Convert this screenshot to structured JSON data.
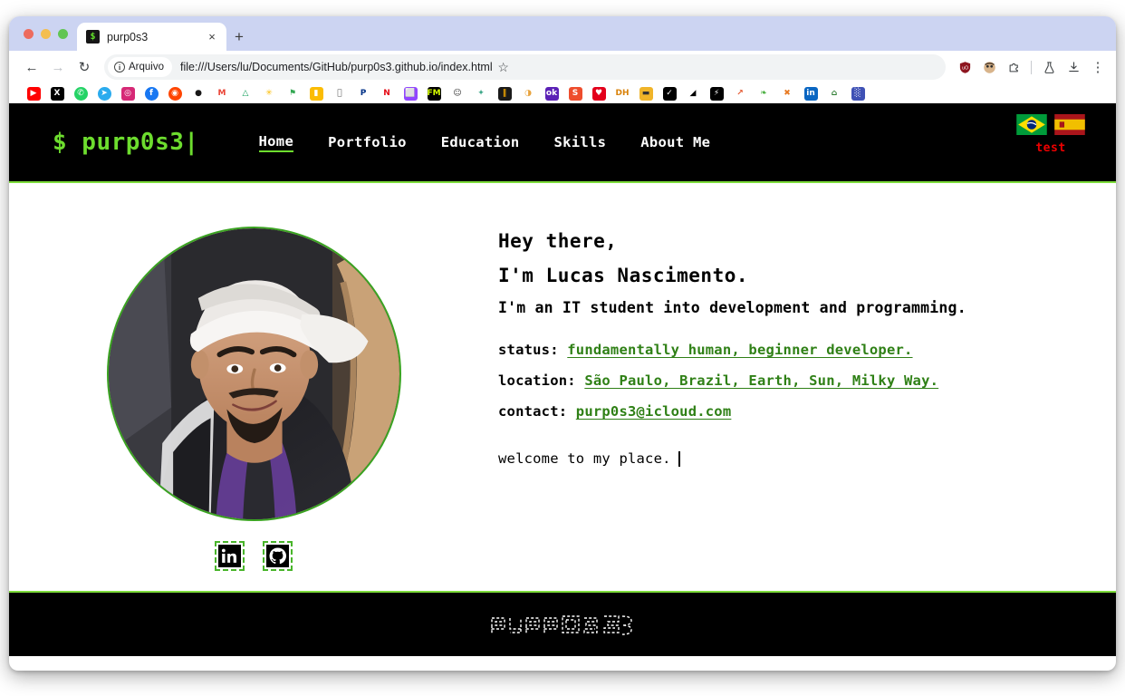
{
  "browser": {
    "tab": {
      "title": "purp0s3",
      "favicon_glyph": "$",
      "close_label": "×"
    },
    "new_tab_label": "+",
    "nav": {
      "back": "←",
      "forward": "→",
      "reload": "↻"
    },
    "omnibox": {
      "site_chip_label": "Arquivo",
      "info_glyph": "i",
      "url": "file:///Users/lu/Documents/GitHub/purp0s3.github.io/index.html"
    },
    "toolbar_icons": [
      {
        "name": "bookmark-star-icon",
        "glyph": "☆"
      },
      {
        "name": "ublock-shield-icon",
        "glyph": "●",
        "color": "#8e1620"
      },
      {
        "name": "extension-avatar-icon",
        "glyph": "●",
        "color": "#c49a6c"
      },
      {
        "name": "extensions-puzzle-icon",
        "glyph": "⬚",
        "color": "#3c4043"
      },
      {
        "name": "labs-flask-icon",
        "glyph": "⚗",
        "color": "#3c4043"
      },
      {
        "name": "downloads-icon",
        "glyph": "⤓",
        "color": "#3c4043"
      },
      {
        "name": "browser-menu-icon",
        "glyph": "⋮",
        "color": "#3c4043"
      }
    ],
    "bookmarks": [
      {
        "name": "youtube",
        "label": "▶",
        "bg": "#ff0000",
        "fg": "#ffffff",
        "shape": "rect"
      },
      {
        "name": "x-twitter",
        "label": "X",
        "bg": "#000000",
        "fg": "#ffffff",
        "shape": "rect"
      },
      {
        "name": "whatsapp",
        "label": "✆",
        "bg": "#25d366",
        "fg": "#ffffff",
        "shape": "circle"
      },
      {
        "name": "telegram",
        "label": "➤",
        "bg": "#2aabee",
        "fg": "#ffffff",
        "shape": "circle"
      },
      {
        "name": "instagram",
        "label": "◎",
        "bg": "#d62976",
        "fg": "#ffffff",
        "shape": "rect"
      },
      {
        "name": "facebook",
        "label": "f",
        "bg": "#1877f2",
        "fg": "#ffffff",
        "shape": "circle"
      },
      {
        "name": "reddit",
        "label": "◉",
        "bg": "#ff4500",
        "fg": "#ffffff",
        "shape": "circle"
      },
      {
        "name": "github",
        "label": "●",
        "bg": "#ffffff",
        "fg": "#181717",
        "shape": "circle"
      },
      {
        "name": "gmail",
        "label": "M",
        "bg": "#ffffff",
        "fg": "#ea4335",
        "shape": "rect"
      },
      {
        "name": "google-drive",
        "label": "△",
        "bg": "#ffffff",
        "fg": "#0f9d58",
        "shape": "rect"
      },
      {
        "name": "google-photos",
        "label": "✳",
        "bg": "#ffffff",
        "fg": "#fbbc04",
        "shape": "rect"
      },
      {
        "name": "google-maps",
        "label": "⚑",
        "bg": "#ffffff",
        "fg": "#34a853",
        "shape": "rect"
      },
      {
        "name": "google-keep",
        "label": "▮",
        "bg": "#fbbc04",
        "fg": "#ffffff",
        "shape": "rect"
      },
      {
        "name": "apple",
        "label": "",
        "bg": "#ffffff",
        "fg": "#555555",
        "shape": "rect"
      },
      {
        "name": "paypal",
        "label": "P",
        "bg": "#ffffff",
        "fg": "#003087",
        "shape": "rect"
      },
      {
        "name": "netflix",
        "label": "N",
        "bg": "#ffffff",
        "fg": "#e50914",
        "shape": "rect"
      },
      {
        "name": "twitch",
        "label": "⬜",
        "bg": "#9146ff",
        "fg": "#ffffff",
        "shape": "rect"
      },
      {
        "name": "fm-app",
        "label": "FM",
        "bg": "#000000",
        "fg": "#d6ff00",
        "shape": "rect"
      },
      {
        "name": "smiley-app",
        "label": "☺",
        "bg": "#ffffff",
        "fg": "#333333",
        "shape": "rect"
      },
      {
        "name": "star-app",
        "label": "✦",
        "bg": "#ffffff",
        "fg": "#3fa88a",
        "shape": "rect"
      },
      {
        "name": "charts-app",
        "label": "‖",
        "bg": "#1a1a1a",
        "fg": "#f0a500",
        "shape": "rect"
      },
      {
        "name": "taco-app",
        "label": "◑",
        "bg": "#ffffff",
        "fg": "#e8a33d",
        "shape": "rect"
      },
      {
        "name": "ok-app",
        "label": "ok",
        "bg": "#5b21b6",
        "fg": "#ffffff",
        "shape": "rect"
      },
      {
        "name": "shopee",
        "label": "S",
        "bg": "#ee4d2d",
        "fg": "#ffffff",
        "shape": "rect"
      },
      {
        "name": "heart-app",
        "label": "♥",
        "bg": "#e3001b",
        "fg": "#ffffff",
        "shape": "rect"
      },
      {
        "name": "dh-app",
        "label": "DH",
        "bg": "#ffffff",
        "fg": "#d9820a",
        "shape": "rect"
      },
      {
        "name": "bag-app",
        "label": "▬",
        "bg": "#f0b429",
        "fg": "#333333",
        "shape": "rect"
      },
      {
        "name": "nike",
        "label": "✓",
        "bg": "#000000",
        "fg": "#ffffff",
        "shape": "rect"
      },
      {
        "name": "adidas",
        "label": "◢",
        "bg": "#ffffff",
        "fg": "#000000",
        "shape": "rect"
      },
      {
        "name": "flash-app",
        "label": "⚡",
        "bg": "#000000",
        "fg": "#ffffff",
        "shape": "rect"
      },
      {
        "name": "swoosh-app",
        "label": "↗",
        "bg": "#ffffff",
        "fg": "#e4572e",
        "shape": "rect"
      },
      {
        "name": "leaf-app",
        "label": "❧",
        "bg": "#ffffff",
        "fg": "#3faa35",
        "shape": "rect"
      },
      {
        "name": "x-orange-app",
        "label": "✖",
        "bg": "#ffffff",
        "fg": "#e87a22",
        "shape": "rect"
      },
      {
        "name": "linkedin",
        "label": "in",
        "bg": "#0a66c2",
        "fg": "#ffffff",
        "shape": "rect"
      },
      {
        "name": "home-app",
        "label": "⌂",
        "bg": "#ffffff",
        "fg": "#2e7d32",
        "shape": "rect"
      },
      {
        "name": "grid-app",
        "label": "░",
        "bg": "#3f51b5",
        "fg": "#ffffff",
        "shape": "rect"
      }
    ]
  },
  "site": {
    "logo": "$ purp0s3|",
    "nav": [
      {
        "label": "Home",
        "active": true
      },
      {
        "label": "Portfolio",
        "active": false
      },
      {
        "label": "Education",
        "active": false
      },
      {
        "label": "Skills",
        "active": false
      },
      {
        "label": "About Me",
        "active": false
      }
    ],
    "lang": {
      "flags": [
        {
          "name": "flag-brazil",
          "label": "Português (Brasil)"
        },
        {
          "name": "flag-spain",
          "label": "Español"
        }
      ],
      "test_label": "test"
    },
    "hero": {
      "avatar_alt": "Lucas Nascimento profile photo",
      "greeting": "Hey there,",
      "name_line": "I'm Lucas Nascimento.",
      "tagline": "I'm an IT student into development and programming.",
      "meta": [
        {
          "key": "status:",
          "value": "fundamentally human, beginner developer."
        },
        {
          "key": "location:",
          "value": "São Paulo, Brazil, Earth, Sun, Milky Way."
        },
        {
          "key": "contact:",
          "value": "purp0s3@icloud.com"
        }
      ],
      "welcome": "welcome to my place.",
      "socials": [
        {
          "name": "linkedin",
          "label": "LinkedIn"
        },
        {
          "name": "github",
          "label": "GitHub"
        }
      ]
    },
    "footer": {
      "logo_text": "purp0s3"
    },
    "colors": {
      "accent_green": "#6ddd2e",
      "border_green": "#7ddc3b",
      "link_green": "#2f8016",
      "test_red": "#ee0000",
      "bar_black": "#000000"
    }
  }
}
